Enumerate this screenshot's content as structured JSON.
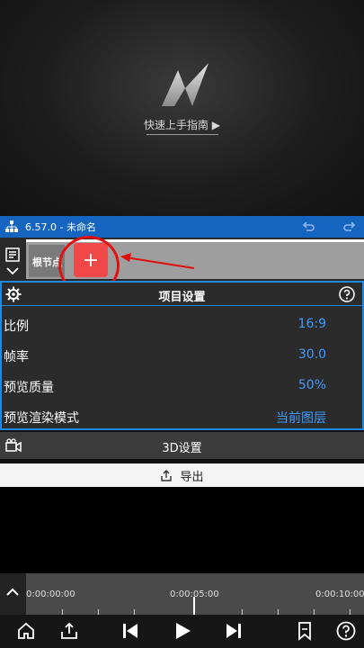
{
  "preview": {
    "guide_text": "快速上手指南 ▶"
  },
  "topbar": {
    "version": "6.57.0 - 未命名",
    "accent": "#1565c0"
  },
  "nodes": {
    "root_label": "根节点",
    "add_icon": "plus-icon"
  },
  "project": {
    "title": "项目设置",
    "rows": [
      {
        "label": "比例",
        "value": "16:9"
      },
      {
        "label": "帧率",
        "value": "30.0"
      },
      {
        "label": "预览质量",
        "value": "50%"
      },
      {
        "label": "预览渲染模式",
        "value": "当前图层"
      }
    ],
    "value_color": "#3d9bff"
  },
  "settings3d": {
    "label": "3D设置"
  },
  "export": {
    "label": "导出"
  },
  "timeline": {
    "times": [
      "0:00:00:00",
      "0:00:05:00",
      "0:00:10:00"
    ]
  }
}
